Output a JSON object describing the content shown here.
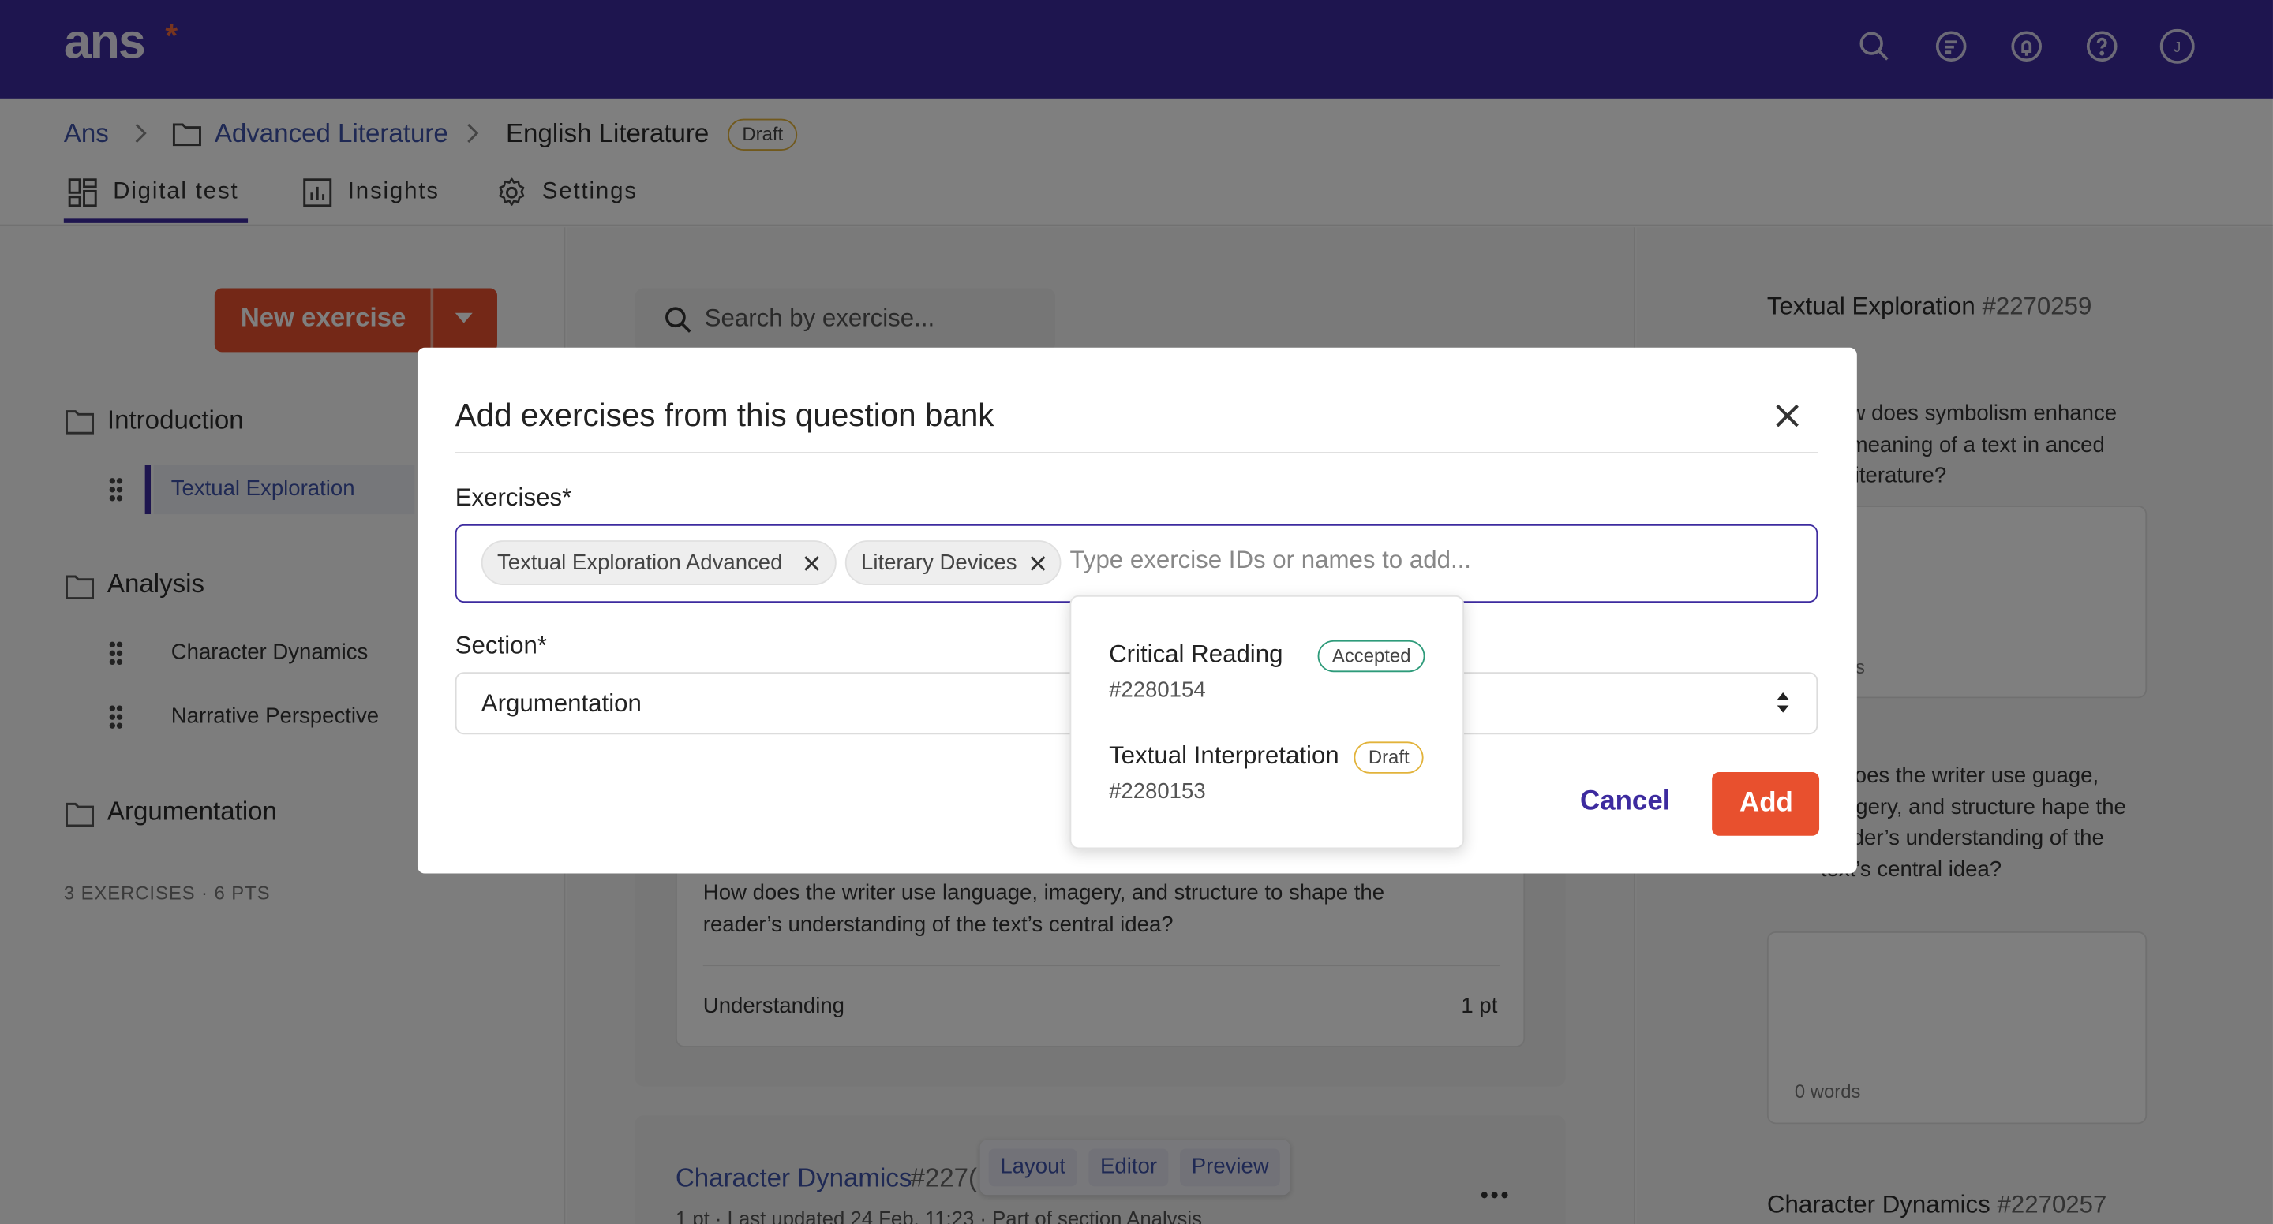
{
  "app": {
    "logo": "ans",
    "logo_mark": "*"
  },
  "topbar": {
    "icons": [
      "search-icon",
      "chat-icon",
      "bell-icon",
      "help-icon",
      "profile-icon"
    ],
    "avatar_initial": "J"
  },
  "breadcrumb": {
    "root": "Ans",
    "folder": "Advanced Literature",
    "current": "English Literature",
    "status": "Draft"
  },
  "tabs": [
    {
      "label": "Digital test",
      "icon": "grid-icon",
      "active": true
    },
    {
      "label": "Insights",
      "icon": "bar-chart-icon",
      "active": false
    },
    {
      "label": "Settings",
      "icon": "gear-icon",
      "active": false
    }
  ],
  "sidebar": {
    "new_exercise_label": "New exercise",
    "sections": [
      {
        "title": "Introduction",
        "exercises": [
          "Textual Exploration"
        ]
      },
      {
        "title": "Analysis",
        "exercises": [
          "Character Dynamics",
          "Narrative Perspective"
        ]
      },
      {
        "title": "Argumentation",
        "exercises": []
      }
    ],
    "active_exercise": "Textual Exploration",
    "summary": "3 EXERCISES · 6 PTS"
  },
  "main": {
    "search_placeholder": "Search by exercise...",
    "card": {
      "question": "How does the writer use language, imagery, and structure to shape the reader’s understanding of the text’s central idea?",
      "category": "Understanding",
      "points": "1 pt"
    },
    "card2": {
      "title": "Character Dynamics",
      "id": "#227(",
      "meta": "1 pt · Last updated 24 Feb, 11:23 · Part of section Analysis"
    },
    "view_buttons": [
      "Layout",
      "Editor",
      "Preview"
    ]
  },
  "preview": {
    "item1": {
      "title": "Textual Exploration",
      "id": "#2270259",
      "question": "w does symbolism enhance meaning of a text in anced literature?",
      "words_fragment": "s"
    },
    "item2": {
      "question": "w does the writer use guage, imagery, and structure hape the reader’s understanding of the text’s central idea?",
      "words": "0 words"
    },
    "item3": {
      "title": "Character Dynamics",
      "id": "#2270257"
    }
  },
  "modal": {
    "title": "Add exercises from this question bank",
    "exercises_label": "Exercises*",
    "selected": [
      "Textual Exploration Advanced",
      "Literary Devices"
    ],
    "input_placeholder": "Type exercise IDs or names to add...",
    "section_label": "Section*",
    "section_value": "Argumentation",
    "cancel_label": "Cancel",
    "add_label": "Add",
    "suggestions": [
      {
        "title": "Critical Reading",
        "id": "#2280154",
        "status": "Accepted"
      },
      {
        "title": "Textual Interpretation",
        "id": "#2280153",
        "status": "Draft"
      }
    ]
  },
  "colors": {
    "brand": "#3d2b9f",
    "accent": "#e8502e",
    "link": "#3e52a8",
    "accepted": "#2e9b7a",
    "draft": "#e2b33b"
  }
}
